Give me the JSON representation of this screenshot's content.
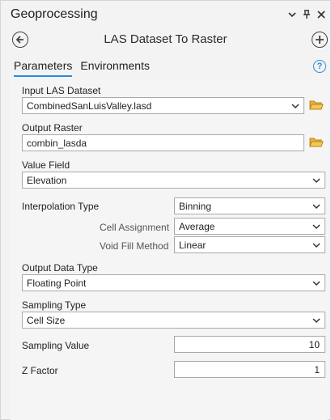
{
  "window": {
    "title": "Geoprocessing"
  },
  "tool": {
    "title": "LAS Dataset To Raster"
  },
  "tabs": [
    {
      "label": "Parameters",
      "active": true
    },
    {
      "label": "Environments",
      "active": false
    }
  ],
  "params": {
    "input_las": {
      "label": "Input LAS Dataset",
      "value": "CombinedSanLuisValley.lasd"
    },
    "output_raster": {
      "label": "Output Raster",
      "value": "combin_lasda"
    },
    "value_field": {
      "label": "Value Field",
      "value": "Elevation"
    },
    "interpolation_type": {
      "label": "Interpolation Type",
      "value": "Binning"
    },
    "cell_assignment": {
      "label": "Cell Assignment",
      "value": "Average"
    },
    "void_fill": {
      "label": "Void Fill Method",
      "value": "Linear"
    },
    "output_data_type": {
      "label": "Output Data Type",
      "value": "Floating Point"
    },
    "sampling_type": {
      "label": "Sampling Type",
      "value": "Cell Size"
    },
    "sampling_value": {
      "label": "Sampling Value",
      "value": "10"
    },
    "z_factor": {
      "label": "Z Factor",
      "value": "1"
    }
  },
  "icons": {
    "back": "back-arrow-icon",
    "add": "add-icon",
    "help": "help-icon",
    "folder": "folder-icon",
    "chevron": "chevron-down-icon"
  },
  "colors": {
    "accent": "#2b8ad8",
    "folder": "#e8b33a"
  }
}
